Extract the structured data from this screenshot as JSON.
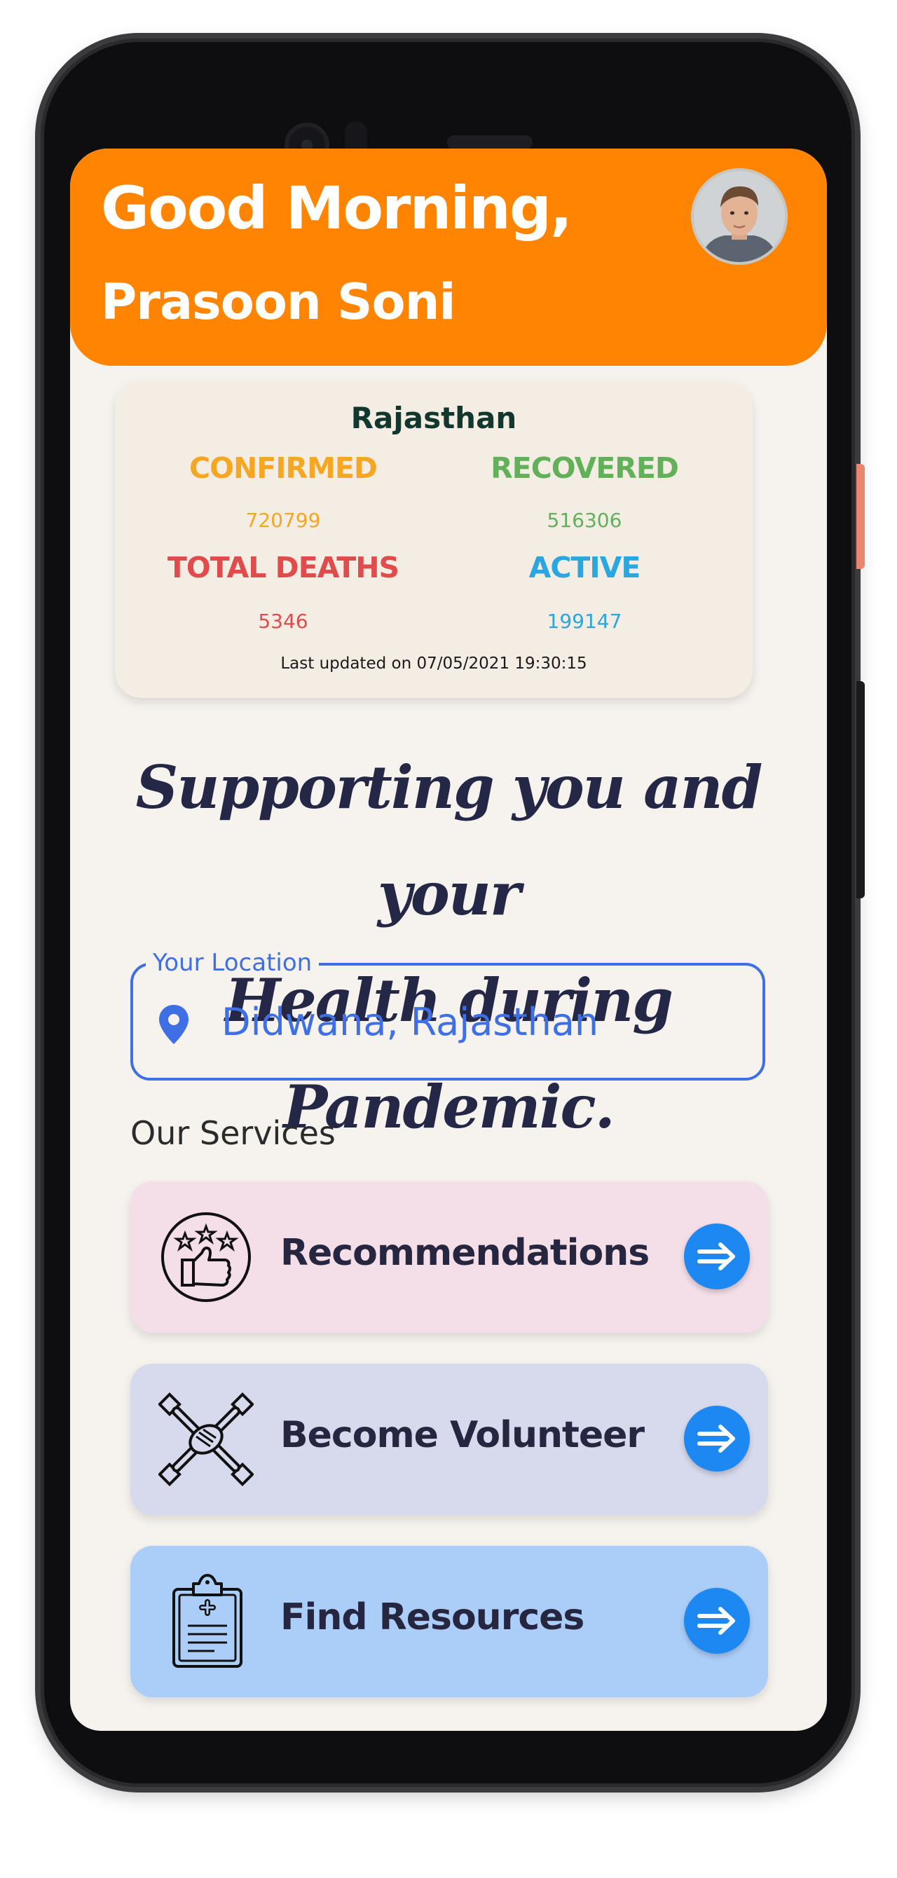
{
  "header": {
    "greeting": "Good Morning,",
    "user_name": "Prasoon Soni",
    "background_color": "#ff8402"
  },
  "stats": {
    "state": "Rajasthan",
    "items": [
      {
        "label": "CONFIRMED",
        "value": "720799",
        "color": "#f5a623"
      },
      {
        "label": "RECOVERED",
        "value": "516306",
        "color": "#62b15a"
      },
      {
        "label": "TOTAL DEATHS",
        "value": "5346",
        "color": "#e24b4b"
      },
      {
        "label": "ACTIVE",
        "value": "199147",
        "color": "#2aa6e0"
      }
    ],
    "last_updated": "Last updated on 07/05/2021 19:30:15"
  },
  "tagline": {
    "line1": "Supporting you and your",
    "line2": "Health during Pandemic."
  },
  "location": {
    "label": "Your Location",
    "value": "Didwana, Rajasthan",
    "icon": "location-pin-icon",
    "accent": "#3f6fe5"
  },
  "services": {
    "title": "Our Services",
    "items": [
      {
        "label": "Recommendations",
        "icon": "thumbs-up-stars-icon",
        "color": "#f4dee8"
      },
      {
        "label": "Become Volunteer",
        "icon": "hands-together-icon",
        "color": "#d7d9ed"
      },
      {
        "label": "Find Resources",
        "icon": "medical-clipboard-icon",
        "color": "#abcef9"
      }
    ],
    "arrow_icon": "double-arrow-right-icon"
  }
}
